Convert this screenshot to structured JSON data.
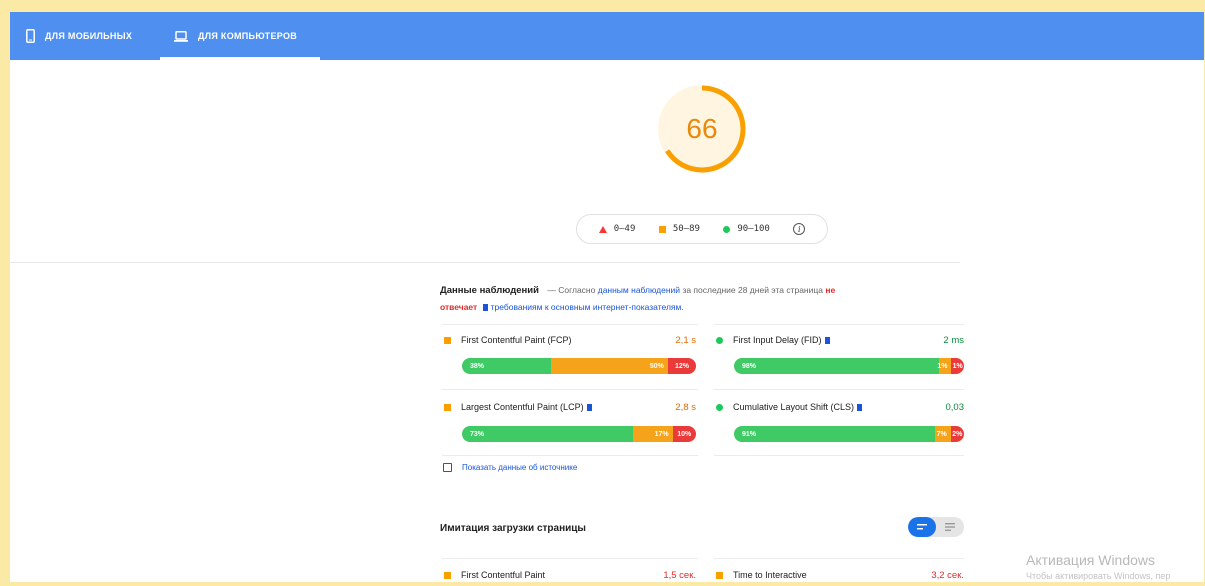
{
  "tabs": {
    "mobile": "ДЛЯ МОБИЛЬНЫХ",
    "desktop": "ДЛЯ КОМПЬЮТЕРОВ"
  },
  "score": {
    "value": "66",
    "fraction": 0.66,
    "color": "#f9a000"
  },
  "legend": {
    "poor": "0–49",
    "average": "50–89",
    "good": "90–100"
  },
  "field": {
    "title": "Данные наблюдений",
    "desc_prefix": "— Согласно",
    "desc_link": "данным наблюдений",
    "desc_mid": "за последние 28 дней эта страница",
    "desc_fail_1": "не",
    "desc_fail_2": "отвечает",
    "desc_link2": "требованиям к основным интернет-показателям.",
    "metrics": {
      "fcp": {
        "name": "First Contentful Paint (FCP)",
        "value": "2,1 s",
        "bar": [
          "38%",
          "50%",
          "12%"
        ],
        "dist": [
          0.38,
          0.5,
          0.12
        ]
      },
      "fid": {
        "name": "First Input Delay (FID)",
        "value": "2 ms",
        "bar": [
          "98%",
          "1%",
          "1%"
        ],
        "dist": [
          0.98,
          0.01,
          0.01
        ]
      },
      "lcp": {
        "name": "Largest Contentful Paint (LCP)",
        "value": "2,8 s",
        "bar": [
          "73%",
          "17%",
          "10%"
        ],
        "dist": [
          0.73,
          0.17,
          0.1
        ]
      },
      "cls": {
        "name": "Cumulative Layout Shift (CLS)",
        "value": "0,03",
        "bar": [
          "91%",
          "7%",
          "2%"
        ],
        "dist": [
          0.91,
          0.07,
          0.02
        ]
      }
    },
    "show_source": "Показать данные об источнике"
  },
  "lab": {
    "title": "Имитация загрузки страницы",
    "row1_left_name": "First Contentful Paint",
    "row1_left_value": "1,5 сек.",
    "row1_right_name": "Time to Interactive",
    "row1_right_value": "3,2 сек."
  },
  "watermark": {
    "line1": "Активация Windows",
    "line2": "Чтобы активировать Windows, пер"
  }
}
